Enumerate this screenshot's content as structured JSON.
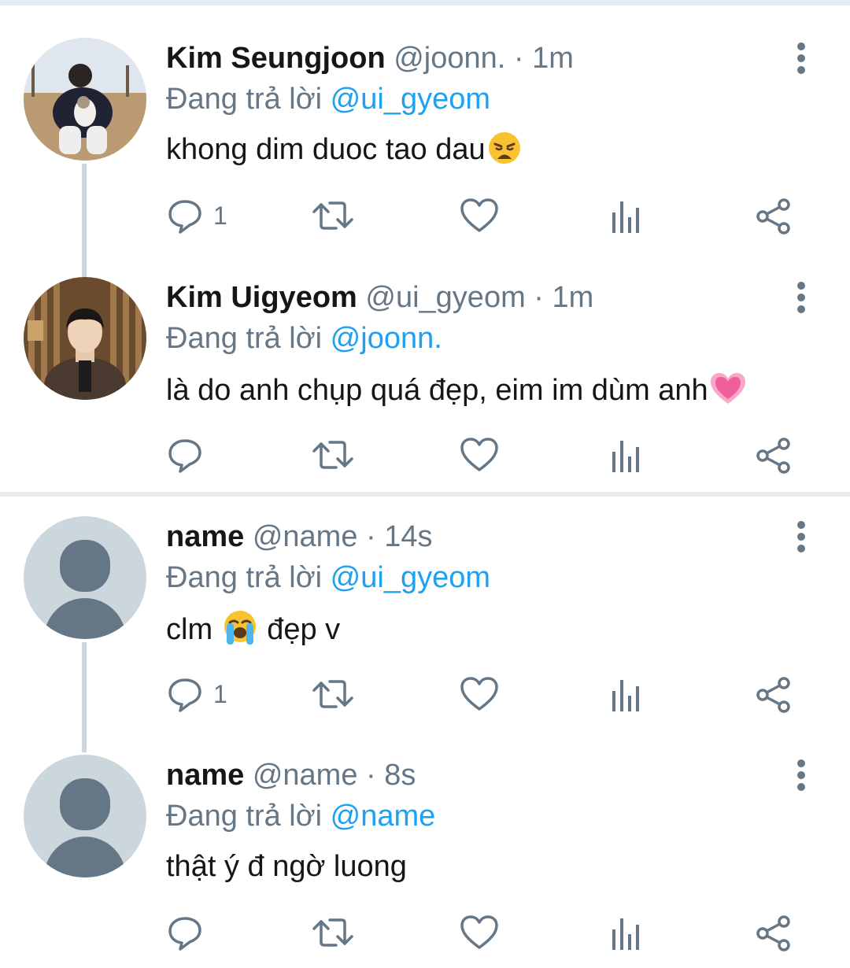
{
  "colors": {
    "text": "#14171a",
    "secondary": "#657786",
    "link": "#1da1f2",
    "divider": "#e6ecf0",
    "thread_line": "#ccd6dd",
    "default_avatar_bg": "#ccd6dd",
    "default_avatar_fg": "#657786"
  },
  "tweets": [
    {
      "display_name": "Kim Seungjoon",
      "handle_time": " @joonn. · 1m",
      "reply_prefix": "Đang trả lời ",
      "reply_mention": "@ui_gyeom",
      "text": "khong dim duoc tao dau",
      "emoji": "weary-face",
      "reply_count": "1",
      "avatar": "photo"
    },
    {
      "display_name": "Kim Uigyeom",
      "handle_time": " @ui_gyeom · 1m",
      "reply_prefix": "Đang trả lời ",
      "reply_mention": "@joonn.",
      "text": "là do anh chụp quá đẹp, eim im dùm anh",
      "emoji": "growing-heart",
      "reply_count": "",
      "avatar": "photo"
    },
    {
      "display_name": "name",
      "handle_time": " @name · 14s",
      "reply_prefix": "Đang trả lời ",
      "reply_mention": "@ui_gyeom",
      "text_before": "clm ",
      "text_after": " đẹp v",
      "emoji": "loudly-crying-face",
      "reply_count": "1",
      "avatar": "default"
    },
    {
      "display_name": "name",
      "handle_time": " @name · 8s",
      "reply_prefix": "Đang trả lời ",
      "reply_mention": "@name",
      "text": "thật ý đ ngờ luong",
      "reply_count": "",
      "avatar": "default"
    }
  ]
}
